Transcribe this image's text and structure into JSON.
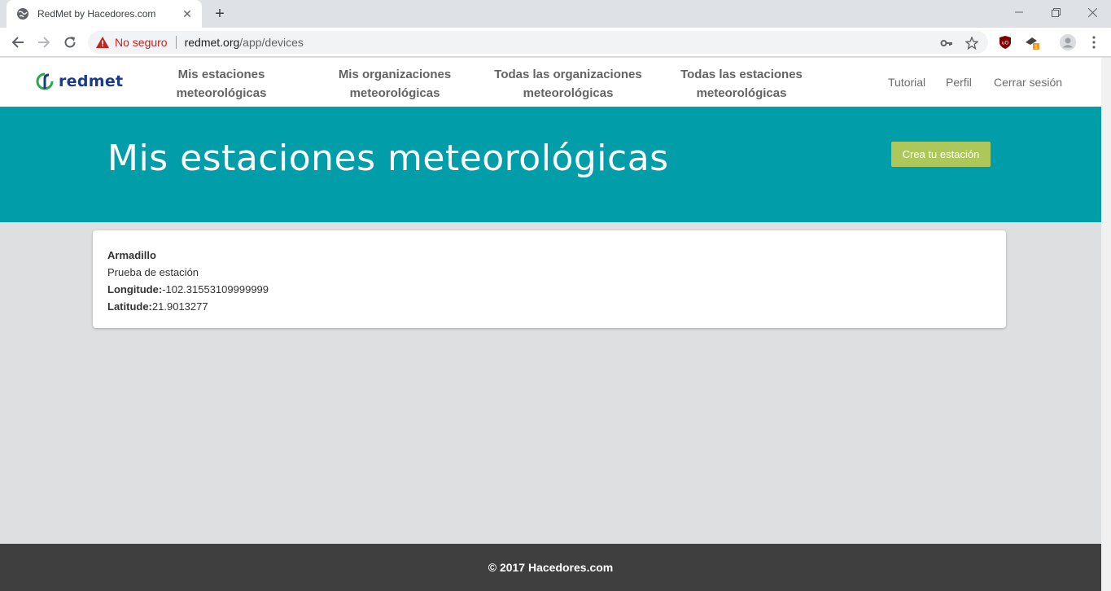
{
  "browser": {
    "tab_title": "RedMet by Hacedores.com",
    "new_tab_label": "+",
    "security_label": "No seguro",
    "url_host": "redmet.org",
    "url_path": "/app/devices"
  },
  "site": {
    "logo_text": "redmet",
    "nav": [
      {
        "line1": "Mis estaciones",
        "line2": "meteorológicas"
      },
      {
        "line1": "Mis organizaciones",
        "line2": "meteorológicas"
      },
      {
        "line1": "Todas las organizaciones",
        "line2": "meteorológicas"
      },
      {
        "line1": "Todas las estaciones",
        "line2": "meteorológicas"
      }
    ],
    "right_links": {
      "tutorial": "Tutorial",
      "profile": "Perfil",
      "logout": "Cerrar sesión"
    }
  },
  "hero": {
    "title": "Mis estaciones meteorológicas",
    "create_button": "Crea tu estación"
  },
  "station": {
    "name": "Armadillo",
    "description": "Prueba de estación",
    "longitude_label": "Longitude:",
    "longitude_value": "-102.31553109999999",
    "latitude_label": "Latitude:",
    "latitude_value": "21.9013277"
  },
  "footer": {
    "text": "© 2017 Hacedores.com"
  },
  "colors": {
    "hero_bg": "#019da8",
    "create_button": "#aec75a",
    "footer_bg": "#3f3f3f",
    "page_bg": "#dedfe1",
    "logo_blue": "#1a3a8a",
    "logo_green": "#2aa84a"
  }
}
